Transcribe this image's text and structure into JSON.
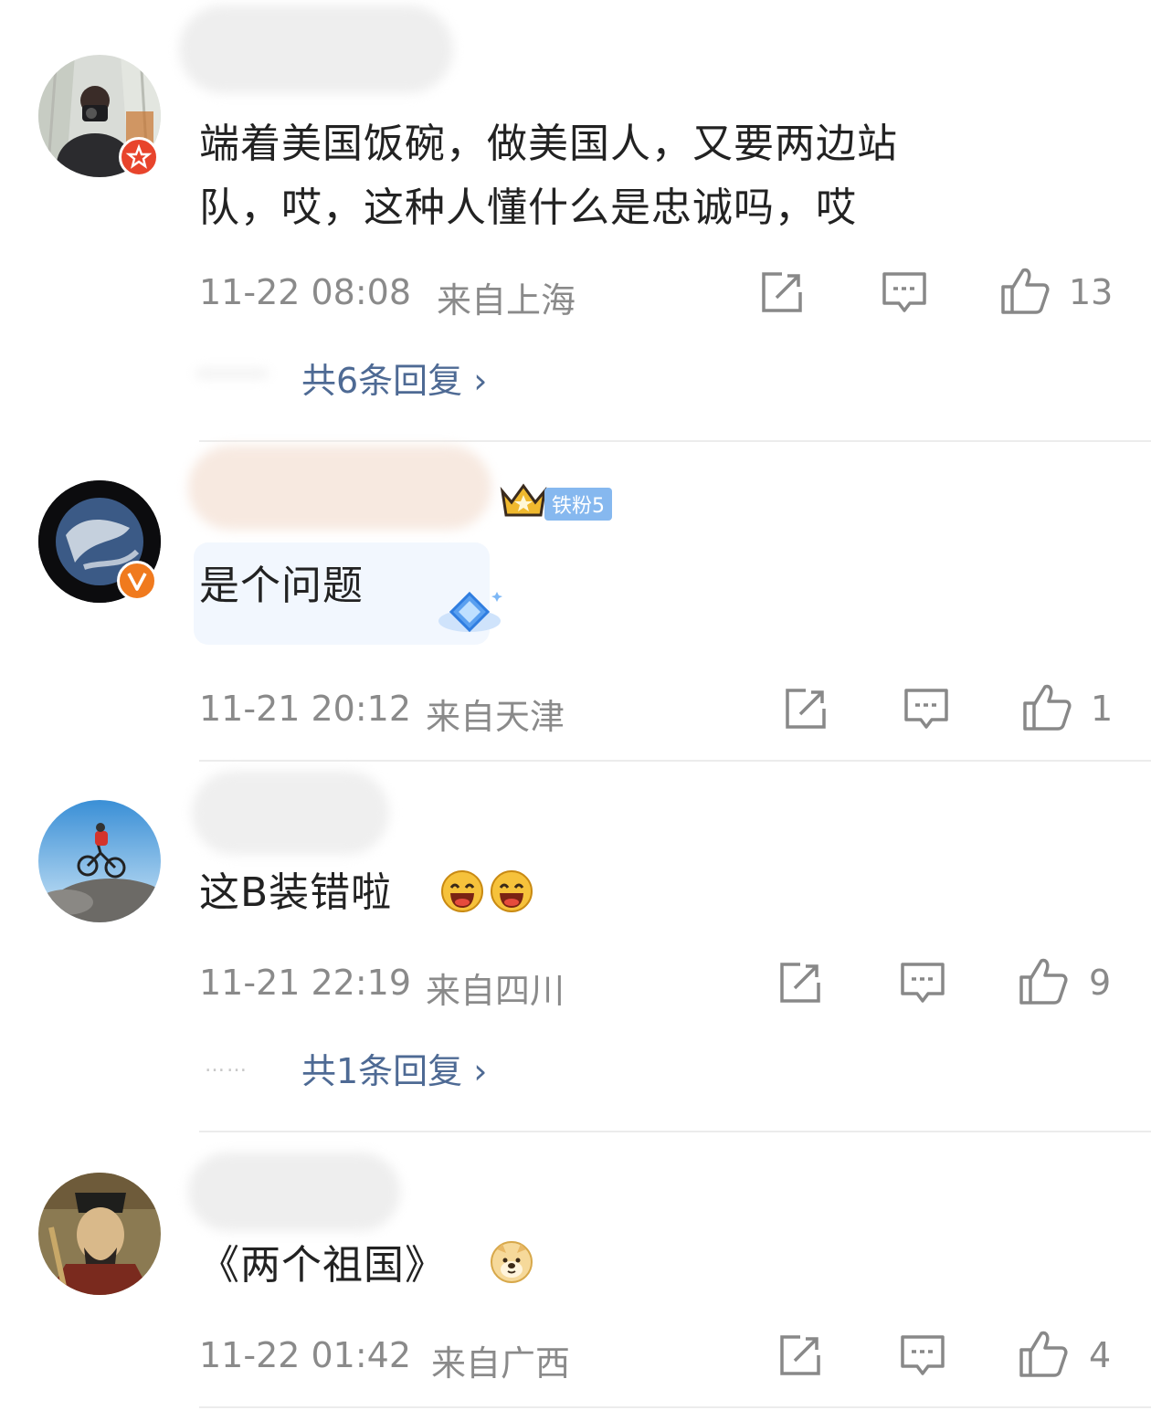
{
  "comments": [
    {
      "text_lines": [
        "端着美国饭碗，做美国人，又要两边站",
        "队，哎，这种人懂什么是忠诚吗，哎"
      ],
      "time": "11-22 08:08",
      "location": "来自上海",
      "likes": "13",
      "replies": "共6条回复",
      "badge_icon": "star-badge-icon"
    },
    {
      "text": "是个问题",
      "fan_badge": "铁粉5",
      "time": "11-21 20:12",
      "location": "来自天津",
      "likes": "1",
      "badge_icon": "verified-v-icon"
    },
    {
      "text": "这B装错啦",
      "time": "11-21 22:19",
      "location": "来自四川",
      "likes": "9",
      "replies": "共1条回复",
      "dots": "……"
    },
    {
      "text": "《两个祖国》",
      "time": "11-22 01:42",
      "location": "来自广西",
      "likes": "4"
    }
  ],
  "colors": {
    "reply_link": "#4e6a94",
    "meta_gray": "#8a8a8a",
    "badge_orange": "#f07a1e",
    "badge_red": "#e8442c"
  }
}
